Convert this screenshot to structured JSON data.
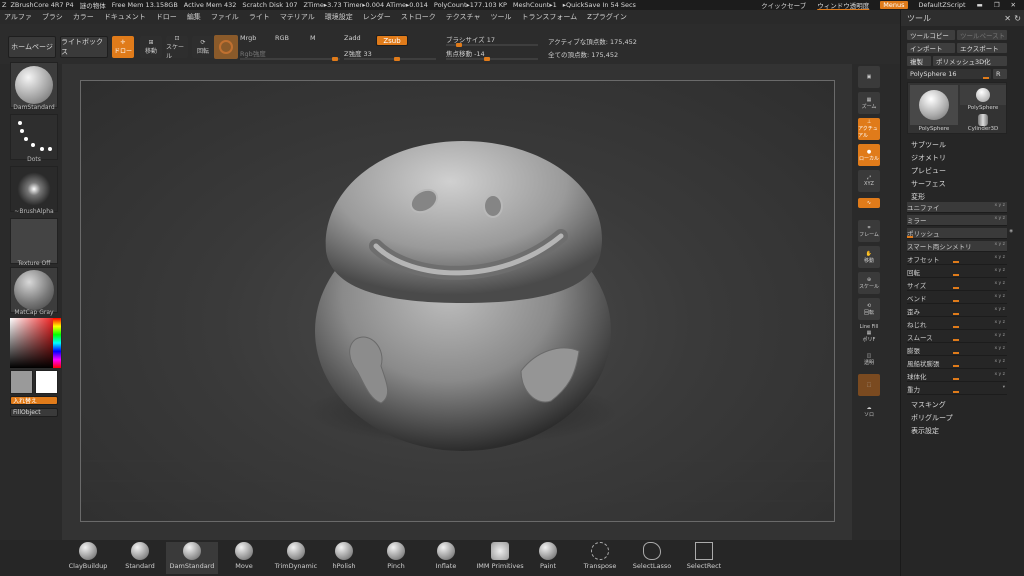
{
  "titlebar": {
    "app": "ZBrushCore 4R7 P4",
    "doc": "謎の物体",
    "free_mem": "Free Mem 13.158GB",
    "active_mem": "Active Mem 432",
    "scratch": "Scratch Disk 107",
    "ztime": "ZTime▸3.73 Timer▸0.004 ATime▸0.014",
    "polycount": "PolyCount▸177.103 KP",
    "meshcount": "MeshCount▸1",
    "quicksave": "▸QuickSave In 54 Secs",
    "quick_save_btn": "クイックセーブ",
    "window_transparency": "ウィンドウ透明度",
    "menus": "Menus",
    "script": "DefaultZScript"
  },
  "menubar": [
    "アルファ",
    "ブラシ",
    "カラー",
    "ドキュメント",
    "ドロー",
    "編集",
    "ファイル",
    "ライト",
    "マテリアル",
    "環境設定",
    "レンダー",
    "ストローク",
    "テクスチャ",
    "ツール",
    "トランスフォーム",
    "Zプラグイン"
  ],
  "topbar": {
    "homepage": "ホームページ",
    "lightbox": "ライトボックス",
    "draw": "ドロー",
    "move": "移動",
    "scale": "スケール",
    "rotate": "回転",
    "mrgb": "Mrgb",
    "rgb": "RGB",
    "m": "M",
    "zadd": "Zadd",
    "zsub": "Zsub",
    "rgb_intensity": "Rgb強度",
    "z_intensity": "Z強度 33",
    "brush_size": "ブラシサイズ 17",
    "focal_shift": "焦点移動 -14",
    "active_points": "アクティブな頂点数: 175,452",
    "total_points": "全ての頂点数: 175,452"
  },
  "leftpanel": {
    "brush": "DamStandard",
    "stroke": "Dots",
    "alpha": "~BrushAlpha",
    "texture": "Texture Off",
    "material": "MatCap Gray",
    "switch": "入れ替え",
    "fill": "FillObject"
  },
  "rightstrip": [
    "ズーム",
    "アクチュアル",
    "ローカル",
    "XYZ",
    "フレーム",
    "移動",
    "スケール",
    "回転",
    "Line Fill",
    "ポリF",
    "透明",
    "ソロ"
  ],
  "toolpanel": {
    "title": "ツール",
    "copy": "ツールコピー",
    "paste": "ツールペースト",
    "import": "インポート",
    "export": "エクスポート",
    "clone": "複製",
    "polymesh": "ポリメッシュ3D化",
    "polysphere_label": "PolySphere",
    "polysphere_value": "16",
    "r_btn": "R",
    "tool1": "PolySphere",
    "tool2": "PolySphere",
    "tool3": "Cylinder3D",
    "sub_sections": [
      "サブツール",
      "ジオメトリ",
      "プレビュー",
      "サーフェス",
      "変形"
    ],
    "deform_rows": [
      "ユニファイ",
      "ミラー",
      "ポリッシュ",
      "スマート両シンメトリ",
      "オフセット",
      "回転",
      "サイズ",
      "ベンド",
      "歪み",
      "ねじれ",
      "スムース",
      "膨張",
      "風船状膨張",
      "球体化",
      "重力"
    ],
    "bottom_sections": [
      "マスキング",
      "ポリグループ",
      "表示設定"
    ]
  },
  "bottombar": [
    "ClayBuildup",
    "Standard",
    "DamStandard",
    "Move",
    "TrimDynamic",
    "hPolish",
    "Pinch",
    "Inflate",
    "IMM Primitives",
    "Paint",
    "Transpose",
    "SelectLasso",
    "SelectRect"
  ],
  "colors": {
    "accent": "#e07b1a",
    "bg": "#262626",
    "panel": "#2a2a2a"
  }
}
